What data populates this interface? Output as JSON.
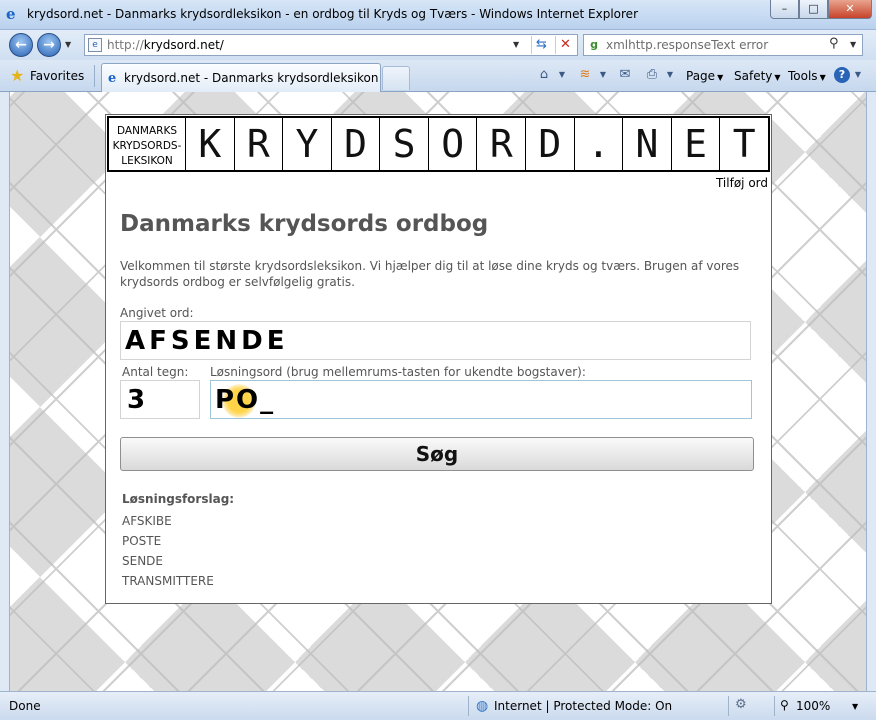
{
  "window": {
    "title": "krydsord.net - Danmarks krydsordleksikon - en ordbog til Kryds og Tværs - Windows Internet Explorer",
    "min": "–",
    "max": "□",
    "close": "✕"
  },
  "address": {
    "url_protocol": "http://",
    "url_host": "krydsord.net/",
    "search_text": "xmlhttp.responseText error"
  },
  "toolbar": {
    "favorites": "Favorites",
    "tab_title": "krydsord.net - Danmarks krydsordleksikon - en or...",
    "page": "Page",
    "safety": "Safety",
    "tools": "Tools"
  },
  "logo": {
    "lexicon_lines": [
      "DANMARKS",
      "KRYDSORDS-",
      "LEKSIKON"
    ],
    "letters": [
      "K",
      "R",
      "Y",
      "D",
      "S",
      "O",
      "R",
      "D",
      ".",
      "N",
      "E",
      "T"
    ]
  },
  "page": {
    "add_word": "Tilføj ord",
    "heading": "Danmarks krydsords ordbog",
    "intro": "Velkommen til største krydsordsleksikon. Vi hjælper dig til at løse dine kryds og tværs. Brugen af vores krydsords ordbog er selvfølgelig gratis.",
    "word_label": "Angivet ord:",
    "word_value": "AFSENDE",
    "count_label": "Antal tegn:",
    "count_value": "3",
    "solution_label": "Løsningsord (brug mellemrums-tasten for ukendte bogstaver):",
    "solution_value": "PO_",
    "search_button": "Søg",
    "suggestions_heading": "Løsningsforslag:",
    "suggestions": [
      "AFSKIBE",
      "POSTE",
      "SENDE",
      "TRANSMITTERE"
    ]
  },
  "status": {
    "done": "Done",
    "zone": "Internet | Protected Mode: On",
    "zoom": "100%"
  }
}
